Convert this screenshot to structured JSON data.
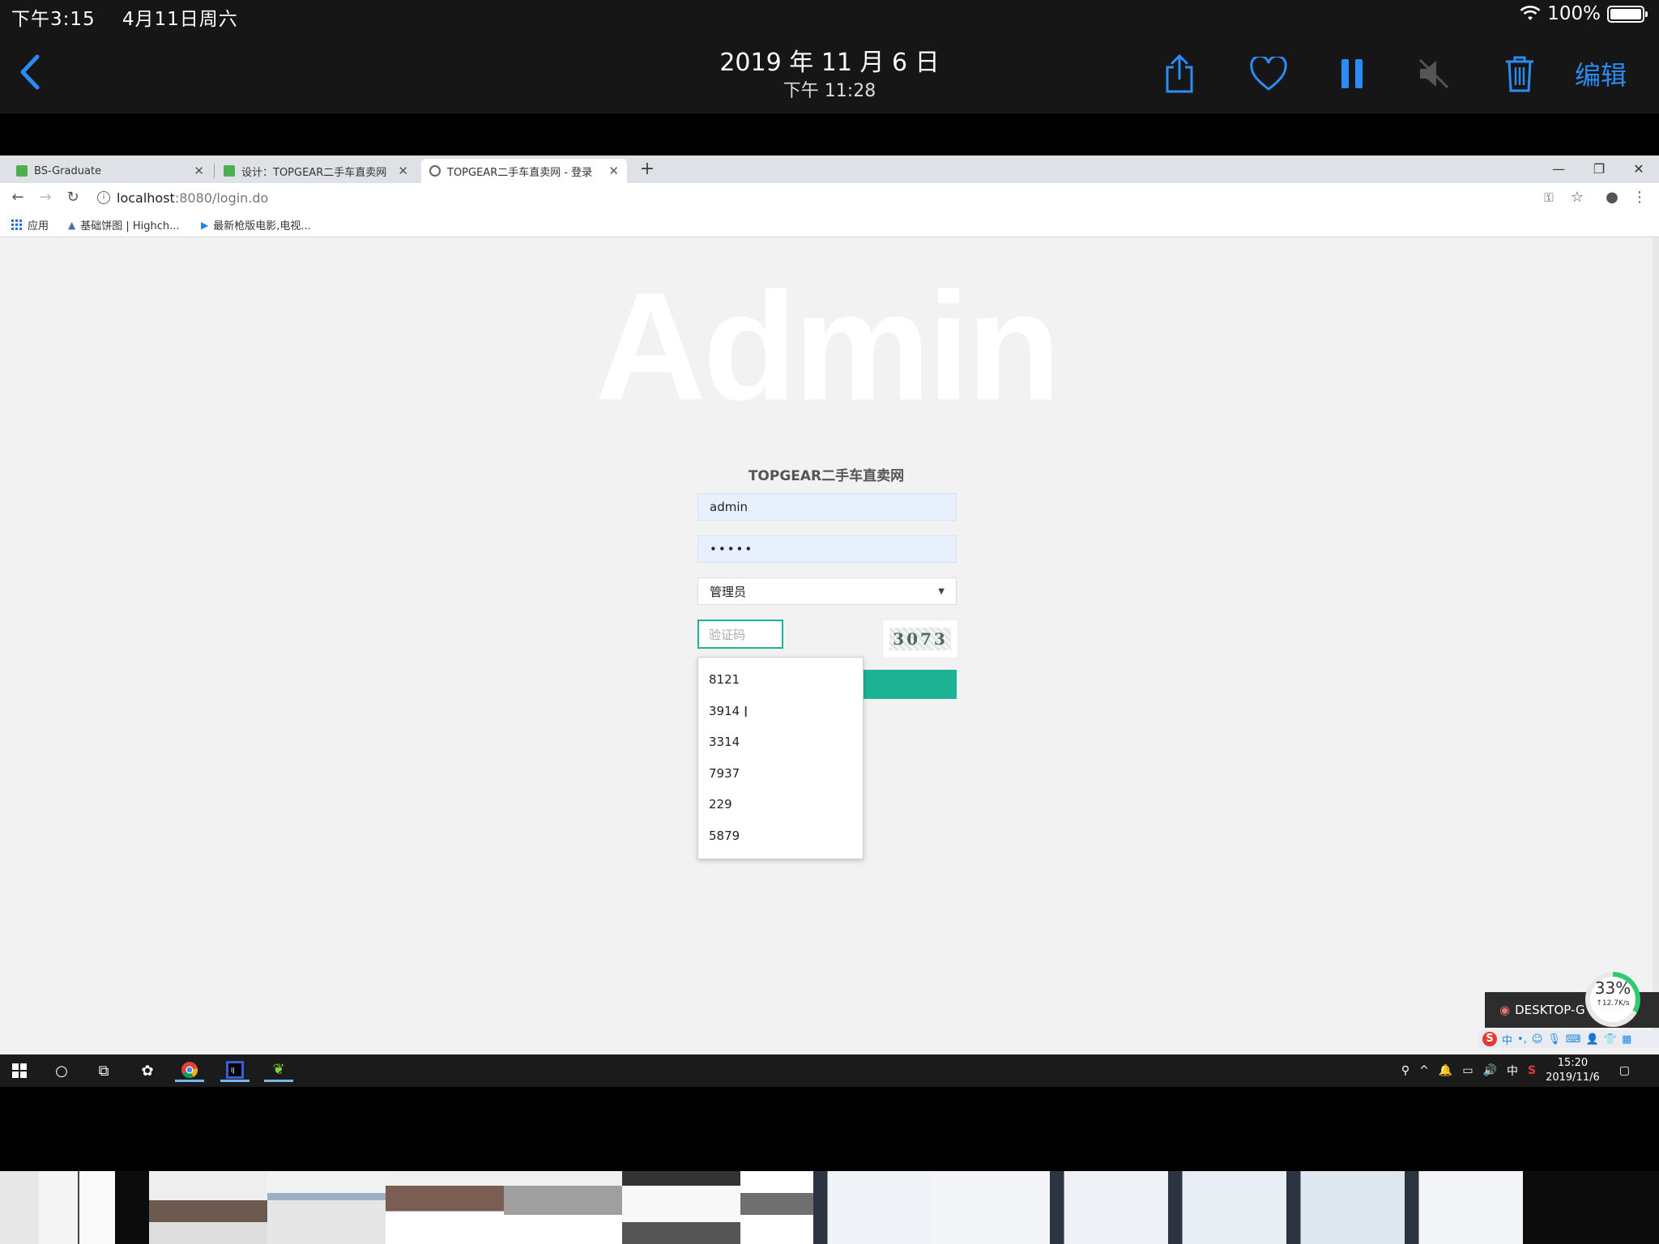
{
  "ios": {
    "status_time": "下午3:15",
    "status_date": "4月11日周六",
    "battery": "100%",
    "battery_level": 1.0,
    "photo_date": "2019 年 11 月 6 日",
    "photo_time": "下午 11:28",
    "edit_label": "编辑",
    "accent": "#2a8cf6"
  },
  "browser": {
    "tabs": [
      {
        "title": "BS-Graduate"
      },
      {
        "title": "设计：TOPGEAR二手车直卖网"
      },
      {
        "title": "TOPGEAR二手车直卖网 - 登录"
      }
    ],
    "url_host": "localhost",
    "url_path": ":8080/login.do",
    "bookmarks": [
      {
        "label": "应用"
      },
      {
        "label": "基础饼图 | Highch..."
      },
      {
        "label": "最新枪版电影,电视..."
      }
    ]
  },
  "login": {
    "hero": "Admin",
    "site_title": "TOPGEAR二手车直卖网",
    "username": "admin",
    "password_mask": "•••••",
    "role": "管理员",
    "captcha_placeholder": "验证码",
    "captcha_code": "3073",
    "accent": "#1cb394",
    "autocomplete": [
      "8121",
      "3914",
      "3314",
      "7937",
      "229",
      "5879"
    ]
  },
  "overlay": {
    "desktop_label": "DESKTOP-G",
    "speed_percent": "33%",
    "speed_level": 0.33,
    "speed_rate": "↑12.7K/s",
    "ime": "中"
  },
  "taskbar": {
    "time": "15:20",
    "date": "2019/11/6",
    "ime": "中"
  }
}
